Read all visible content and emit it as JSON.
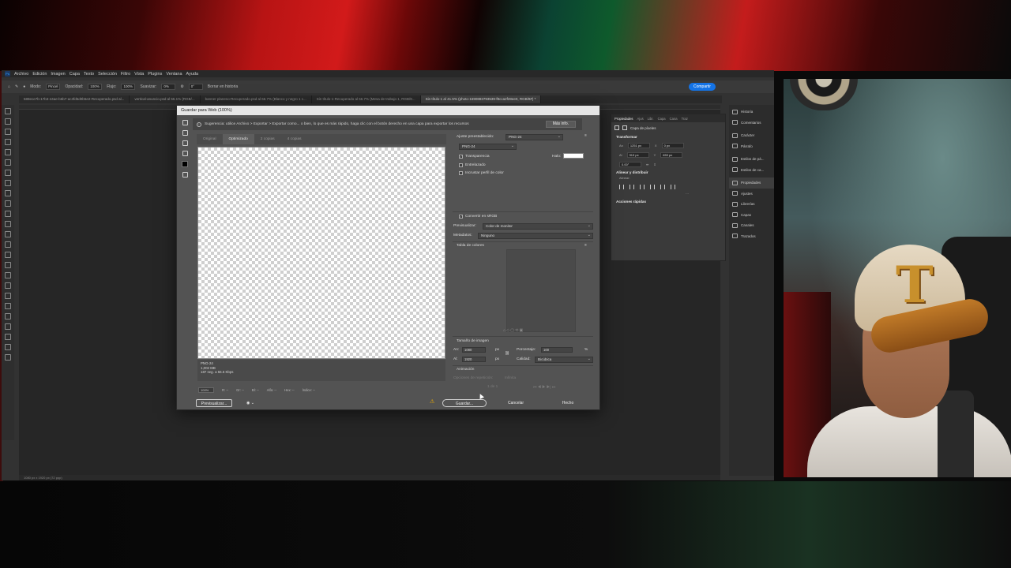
{
  "menubar": {
    "items": [
      "Archivo",
      "Edición",
      "Imagen",
      "Capa",
      "Texto",
      "Selección",
      "Filtro",
      "Vista",
      "Plugins",
      "Ventana",
      "Ayuda"
    ]
  },
  "optionsbar": {
    "mode_label": "Modo:",
    "mode_value": "Pincel",
    "opacity_label": "Opacidad:",
    "opacity_value": "100%",
    "flow_label": "Flujo:",
    "flow_value": "100%",
    "smoothing_label": "Suavizar:",
    "smoothing_value": "0%",
    "angle_value": "0°",
    "erase_history_label": "Borrar en historia",
    "share_label": "Compartir"
  },
  "doc_tabs": [
    {
      "label": "589ece7b-17b3-44ae-b6b7-ac3fd5d0b5e2-Recuperado.psd al..."
    },
    {
      "label": "vertical-anuncio.psd al 55.1% (RGB/..."
    },
    {
      "label": "banner planeso-Recuperado.psd al 66.7% (Blanco y negro 1 c..."
    },
    {
      "label": "Sin título-1-Recuperado al 66.7% (Mesa de trabajo 1, RGB/8..."
    },
    {
      "label": "Sin título-1 al 41.5% (photo-1690883793539-f8cca2f28ee0, RGB/8#) *"
    }
  ],
  "right_panel": {
    "items": [
      "Historia",
      "Comentarios",
      "Carácter",
      "Párrafo",
      "Estilos de pá...",
      "Estilos de ca...",
      "Propiedades",
      "Ajustes",
      "Librerías",
      "Capas",
      "Canales",
      "Trazados"
    ],
    "active": "Propiedades"
  },
  "properties": {
    "tabs": [
      "Propiedades",
      "Ajus",
      "Libr.",
      "Capa",
      "Cana",
      "Traz"
    ],
    "layer_label": "Capa de píxeles",
    "transform_label": "Transformar",
    "w_label": "An",
    "w_value": "1251 px",
    "x_label": "X",
    "x_value": "0 px",
    "h_label": "Al",
    "h_value": "913 px",
    "y_label": "Y",
    "y_value": "653 px",
    "angle_value": "0.00°",
    "align_label": "Alinear y distribuir",
    "align_sub": "Alinear:",
    "more": "···",
    "quick_actions": "Acciones rápidas"
  },
  "dialog": {
    "title": "Guardar para Web (100%)",
    "tip": "Sugerencia: utilice Archivo > Exportar > Exportar como... o bien, lo que es más rápido, haga clic con el botón derecho en una capa para exportar los recursos",
    "more_info": "Más info.",
    "view_tabs": [
      "Original",
      "Optimizado",
      "2 copias",
      "4 copias"
    ],
    "active_tab": "Optimizado",
    "preview_info": [
      "PNG-24",
      "1,002 MB",
      "187 seg. a 56.6 Kbps"
    ],
    "zoom": "100%",
    "r_label": "R: --",
    "g_label": "Gr: --",
    "b_label": "Bl: --",
    "alpha_label": "Alfa: --",
    "hex_label": "Hex: --",
    "index_label": "Índice: --",
    "preset_label": "Ajuste preestablecido:",
    "preset_value": "PNG-24",
    "format_value": "PNG-24",
    "transparency_label": "Transparencia",
    "matte_label": "Halo:",
    "interlaced_label": "Entrelazado",
    "embed_profile_label": "Incrustar perfil de color",
    "convert_srgb_label": "Convertir en sRGB",
    "preview_label": "Previsualizar:",
    "preview_value": "Color de monitor",
    "metadata_label": "Metadatos:",
    "metadata_value": "Ninguno",
    "color_table_label": "Tabla de colores",
    "image_size_label": "Tamaño de imagen",
    "w_label": "An:",
    "w_value": "1080",
    "h_label": "Al:",
    "h_value": "1920",
    "px_unit": "px",
    "percent_label": "Porcentaje:",
    "percent_value": "100",
    "percent_unit": "%",
    "quality_label": "Calidad:",
    "quality_value": "Bicúbica",
    "animation_label": "Animación",
    "loop_label": "Opciones de repetición:",
    "loop_value": "Infinita",
    "frame_value": "1 de 1",
    "preview_button": "Previsualizar...",
    "save_button": "Guardar...",
    "cancel_button": "Cancelar",
    "done_button": "Hecho"
  },
  "status_bar": "1080 px x 1920 px (72 ppp)"
}
